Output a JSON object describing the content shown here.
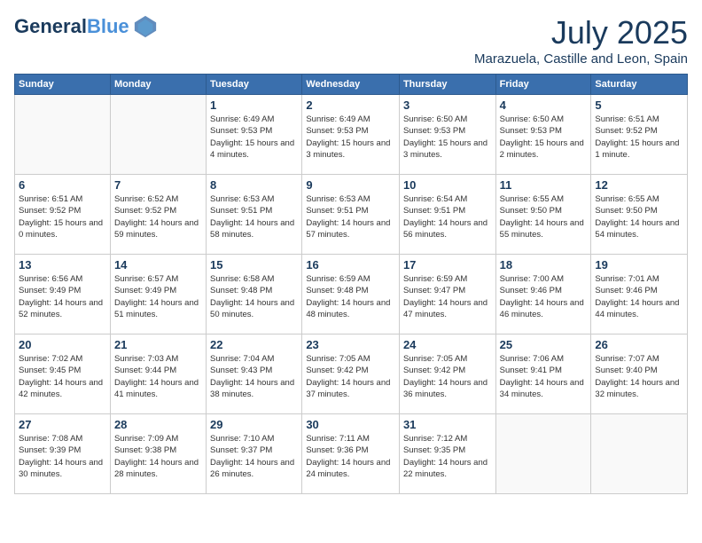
{
  "header": {
    "logo_line1": "General",
    "logo_line2": "Blue",
    "month": "July 2025",
    "location": "Marazuela, Castille and Leon, Spain"
  },
  "days_of_week": [
    "Sunday",
    "Monday",
    "Tuesday",
    "Wednesday",
    "Thursday",
    "Friday",
    "Saturday"
  ],
  "weeks": [
    [
      {
        "num": "",
        "sunrise": "",
        "sunset": "",
        "daylight": ""
      },
      {
        "num": "",
        "sunrise": "",
        "sunset": "",
        "daylight": ""
      },
      {
        "num": "1",
        "sunrise": "Sunrise: 6:49 AM",
        "sunset": "Sunset: 9:53 PM",
        "daylight": "Daylight: 15 hours and 4 minutes."
      },
      {
        "num": "2",
        "sunrise": "Sunrise: 6:49 AM",
        "sunset": "Sunset: 9:53 PM",
        "daylight": "Daylight: 15 hours and 3 minutes."
      },
      {
        "num": "3",
        "sunrise": "Sunrise: 6:50 AM",
        "sunset": "Sunset: 9:53 PM",
        "daylight": "Daylight: 15 hours and 3 minutes."
      },
      {
        "num": "4",
        "sunrise": "Sunrise: 6:50 AM",
        "sunset": "Sunset: 9:53 PM",
        "daylight": "Daylight: 15 hours and 2 minutes."
      },
      {
        "num": "5",
        "sunrise": "Sunrise: 6:51 AM",
        "sunset": "Sunset: 9:52 PM",
        "daylight": "Daylight: 15 hours and 1 minute."
      }
    ],
    [
      {
        "num": "6",
        "sunrise": "Sunrise: 6:51 AM",
        "sunset": "Sunset: 9:52 PM",
        "daylight": "Daylight: 15 hours and 0 minutes."
      },
      {
        "num": "7",
        "sunrise": "Sunrise: 6:52 AM",
        "sunset": "Sunset: 9:52 PM",
        "daylight": "Daylight: 14 hours and 59 minutes."
      },
      {
        "num": "8",
        "sunrise": "Sunrise: 6:53 AM",
        "sunset": "Sunset: 9:51 PM",
        "daylight": "Daylight: 14 hours and 58 minutes."
      },
      {
        "num": "9",
        "sunrise": "Sunrise: 6:53 AM",
        "sunset": "Sunset: 9:51 PM",
        "daylight": "Daylight: 14 hours and 57 minutes."
      },
      {
        "num": "10",
        "sunrise": "Sunrise: 6:54 AM",
        "sunset": "Sunset: 9:51 PM",
        "daylight": "Daylight: 14 hours and 56 minutes."
      },
      {
        "num": "11",
        "sunrise": "Sunrise: 6:55 AM",
        "sunset": "Sunset: 9:50 PM",
        "daylight": "Daylight: 14 hours and 55 minutes."
      },
      {
        "num": "12",
        "sunrise": "Sunrise: 6:55 AM",
        "sunset": "Sunset: 9:50 PM",
        "daylight": "Daylight: 14 hours and 54 minutes."
      }
    ],
    [
      {
        "num": "13",
        "sunrise": "Sunrise: 6:56 AM",
        "sunset": "Sunset: 9:49 PM",
        "daylight": "Daylight: 14 hours and 52 minutes."
      },
      {
        "num": "14",
        "sunrise": "Sunrise: 6:57 AM",
        "sunset": "Sunset: 9:49 PM",
        "daylight": "Daylight: 14 hours and 51 minutes."
      },
      {
        "num": "15",
        "sunrise": "Sunrise: 6:58 AM",
        "sunset": "Sunset: 9:48 PM",
        "daylight": "Daylight: 14 hours and 50 minutes."
      },
      {
        "num": "16",
        "sunrise": "Sunrise: 6:59 AM",
        "sunset": "Sunset: 9:48 PM",
        "daylight": "Daylight: 14 hours and 48 minutes."
      },
      {
        "num": "17",
        "sunrise": "Sunrise: 6:59 AM",
        "sunset": "Sunset: 9:47 PM",
        "daylight": "Daylight: 14 hours and 47 minutes."
      },
      {
        "num": "18",
        "sunrise": "Sunrise: 7:00 AM",
        "sunset": "Sunset: 9:46 PM",
        "daylight": "Daylight: 14 hours and 46 minutes."
      },
      {
        "num": "19",
        "sunrise": "Sunrise: 7:01 AM",
        "sunset": "Sunset: 9:46 PM",
        "daylight": "Daylight: 14 hours and 44 minutes."
      }
    ],
    [
      {
        "num": "20",
        "sunrise": "Sunrise: 7:02 AM",
        "sunset": "Sunset: 9:45 PM",
        "daylight": "Daylight: 14 hours and 42 minutes."
      },
      {
        "num": "21",
        "sunrise": "Sunrise: 7:03 AM",
        "sunset": "Sunset: 9:44 PM",
        "daylight": "Daylight: 14 hours and 41 minutes."
      },
      {
        "num": "22",
        "sunrise": "Sunrise: 7:04 AM",
        "sunset": "Sunset: 9:43 PM",
        "daylight": "Daylight: 14 hours and 38 minutes."
      },
      {
        "num": "23",
        "sunrise": "Sunrise: 7:05 AM",
        "sunset": "Sunset: 9:42 PM",
        "daylight": "Daylight: 14 hours and 37 minutes."
      },
      {
        "num": "24",
        "sunrise": "Sunrise: 7:05 AM",
        "sunset": "Sunset: 9:42 PM",
        "daylight": "Daylight: 14 hours and 36 minutes."
      },
      {
        "num": "25",
        "sunrise": "Sunrise: 7:06 AM",
        "sunset": "Sunset: 9:41 PM",
        "daylight": "Daylight: 14 hours and 34 minutes."
      },
      {
        "num": "26",
        "sunrise": "Sunrise: 7:07 AM",
        "sunset": "Sunset: 9:40 PM",
        "daylight": "Daylight: 14 hours and 32 minutes."
      }
    ],
    [
      {
        "num": "27",
        "sunrise": "Sunrise: 7:08 AM",
        "sunset": "Sunset: 9:39 PM",
        "daylight": "Daylight: 14 hours and 30 minutes."
      },
      {
        "num": "28",
        "sunrise": "Sunrise: 7:09 AM",
        "sunset": "Sunset: 9:38 PM",
        "daylight": "Daylight: 14 hours and 28 minutes."
      },
      {
        "num": "29",
        "sunrise": "Sunrise: 7:10 AM",
        "sunset": "Sunset: 9:37 PM",
        "daylight": "Daylight: 14 hours and 26 minutes."
      },
      {
        "num": "30",
        "sunrise": "Sunrise: 7:11 AM",
        "sunset": "Sunset: 9:36 PM",
        "daylight": "Daylight: 14 hours and 24 minutes."
      },
      {
        "num": "31",
        "sunrise": "Sunrise: 7:12 AM",
        "sunset": "Sunset: 9:35 PM",
        "daylight": "Daylight: 14 hours and 22 minutes."
      },
      {
        "num": "",
        "sunrise": "",
        "sunset": "",
        "daylight": ""
      },
      {
        "num": "",
        "sunrise": "",
        "sunset": "",
        "daylight": ""
      }
    ]
  ]
}
